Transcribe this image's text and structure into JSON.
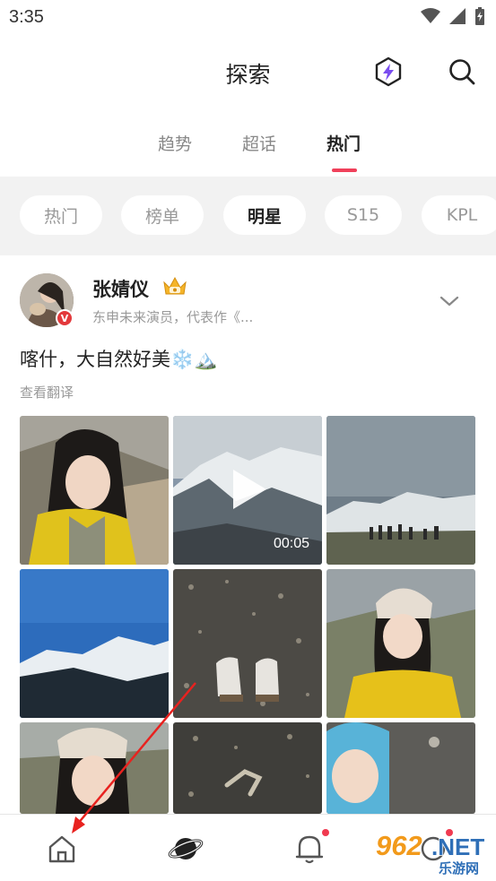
{
  "status_bar": {
    "time": "3:35"
  },
  "header": {
    "title": "探索"
  },
  "tabs": [
    {
      "label": "趋势"
    },
    {
      "label": "超话"
    },
    {
      "label": "热门"
    }
  ],
  "chips": [
    {
      "label": "热门"
    },
    {
      "label": "榜单"
    },
    {
      "label": "明星"
    },
    {
      "label": "S15"
    },
    {
      "label": "KPL"
    }
  ],
  "post": {
    "author_name": "张婧仪",
    "author_badge": "V",
    "author_desc": "东申未来演员，代表作《...",
    "text": "喀什，大自然好美❄️🏔️",
    "translate_label": "查看翻译",
    "video_duration": "00:05"
  },
  "watermark": {
    "brand": "962.NET",
    "sub": "乐游网"
  },
  "colors": {
    "accent": "#f0405a",
    "badge_red": "#e3393c"
  },
  "icons": [
    "lightning-hexagon-icon",
    "search-icon",
    "home-icon",
    "planet-icon",
    "bell-icon",
    "play-icon",
    "chevron-down-icon",
    "crown-icon"
  ]
}
